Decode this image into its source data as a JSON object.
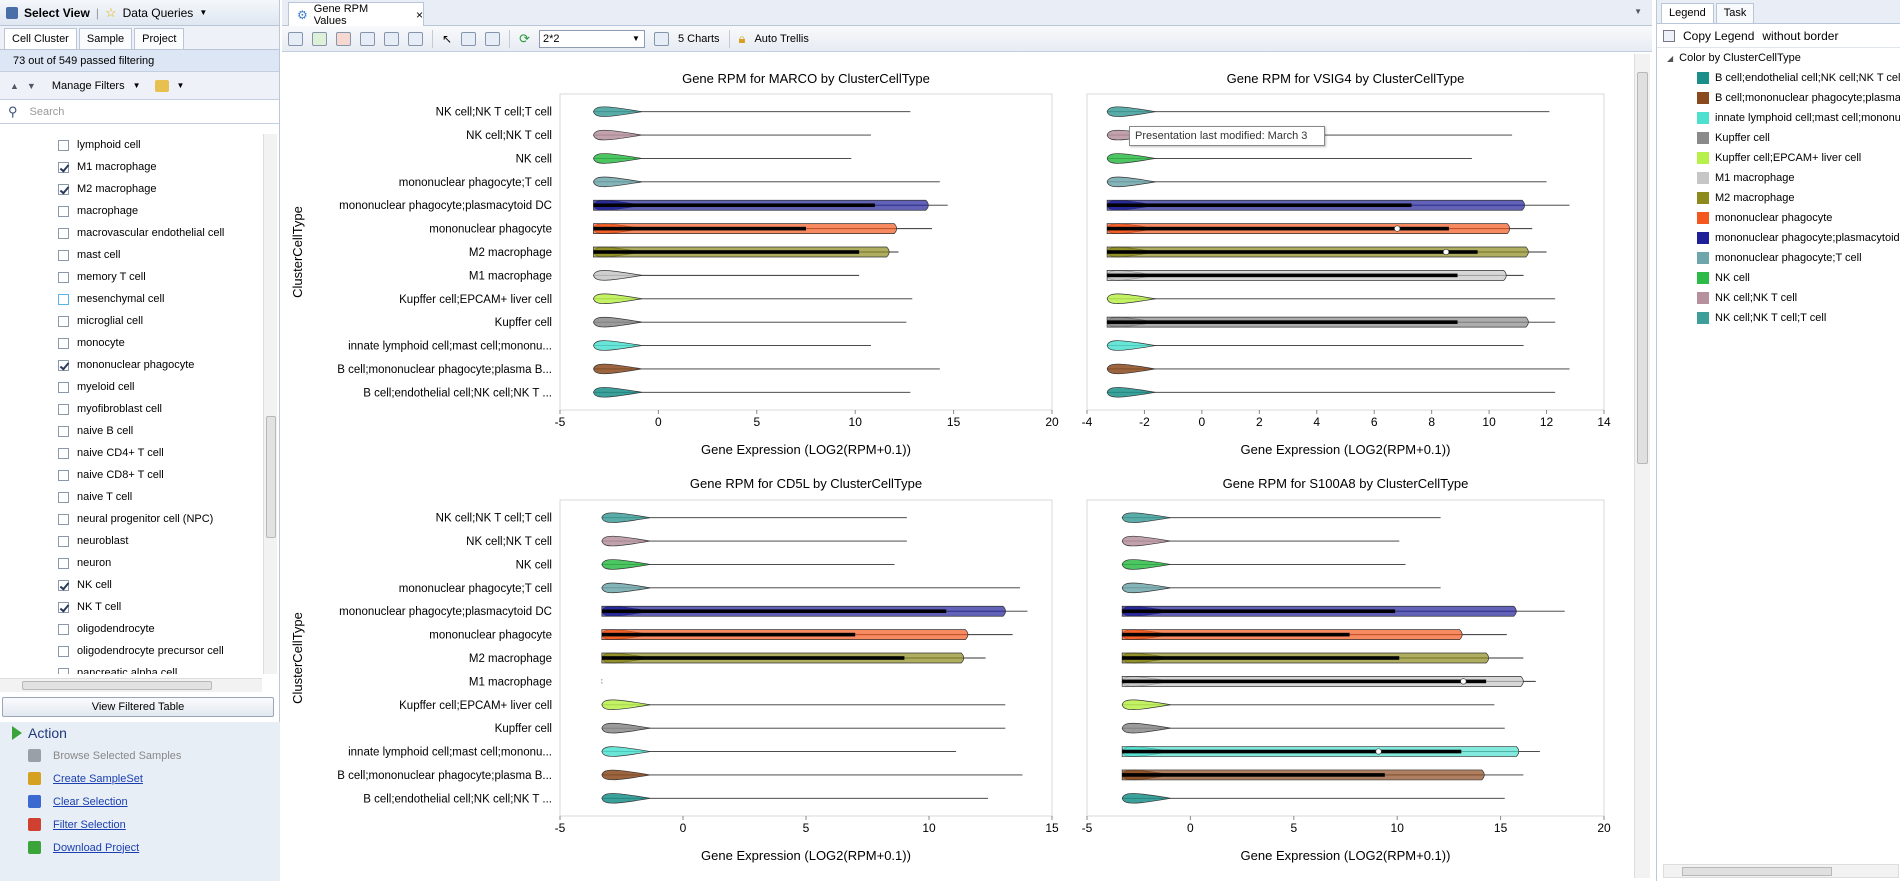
{
  "left": {
    "select_view": "Select View",
    "data_queries": "Data Queries",
    "tabs": [
      "Cell Cluster",
      "Sample",
      "Project"
    ],
    "passed": "73 out of 549 passed filtering",
    "manage_filters": "Manage Filters",
    "search_placeholder": "Search",
    "filter_items": [
      {
        "label": "lymphoid cell",
        "checked": false
      },
      {
        "label": "M1 macrophage",
        "checked": true
      },
      {
        "label": "M2 macrophage",
        "checked": true
      },
      {
        "label": "macrophage",
        "checked": false
      },
      {
        "label": "macrovascular endothelial cell",
        "checked": false
      },
      {
        "label": "mast cell",
        "checked": false
      },
      {
        "label": "memory T cell",
        "checked": false
      },
      {
        "label": "mesenchymal cell",
        "checked": false
      },
      {
        "label": "microglial cell",
        "checked": false
      },
      {
        "label": "monocyte",
        "checked": false
      },
      {
        "label": "mononuclear phagocyte",
        "checked": true
      },
      {
        "label": "myeloid cell",
        "checked": false
      },
      {
        "label": "myofibroblast cell",
        "checked": false
      },
      {
        "label": "naive B cell",
        "checked": false
      },
      {
        "label": "naive CD4+ T cell",
        "checked": false
      },
      {
        "label": "naive CD8+ T cell",
        "checked": false
      },
      {
        "label": "naive T cell",
        "checked": false
      },
      {
        "label": "neural progenitor cell (NPC)",
        "checked": false
      },
      {
        "label": "neuroblast",
        "checked": false
      },
      {
        "label": "neuron",
        "checked": false
      },
      {
        "label": "NK cell",
        "checked": true
      },
      {
        "label": "NK T cell",
        "checked": true
      },
      {
        "label": "oligodendrocyte",
        "checked": false
      },
      {
        "label": "oligodendrocyte precursor cell",
        "checked": false
      },
      {
        "label": "pancreatic alpha cell",
        "checked": false
      }
    ],
    "view_filtered_table": "View Filtered Table",
    "action_title": "Action",
    "actions": [
      {
        "label": "Browse Selected Samples",
        "enabled": false,
        "color": "#9aa0a8"
      },
      {
        "label": "Create SampleSet",
        "enabled": true,
        "color": "#d6a020"
      },
      {
        "label": "Clear Selection",
        "enabled": true,
        "color": "#3a6ad0"
      },
      {
        "label": "Filter Selection",
        "enabled": true,
        "color": "#d04030"
      },
      {
        "label": "Download Project",
        "enabled": true,
        "color": "#3aa33a"
      }
    ]
  },
  "center": {
    "tab_label": "Gene RPM Values",
    "trellis_value": "2*2",
    "charts_count": "5 Charts",
    "auto_trellis": "Auto Trellis",
    "tooltip": "Presentation last modified: March 3"
  },
  "legend": {
    "tabs": [
      "Legend",
      "Task"
    ],
    "copy_legend": "Copy Legend",
    "without_border": "without border",
    "color_by": "Color by ClusterCellType",
    "items": [
      {
        "label": "B cell;endothelial cell;NK cell;NK T cell",
        "color": "#1a8f8a"
      },
      {
        "label": "B cell;mononuclear phagocyte;plasma B",
        "color": "#8b4a1e"
      },
      {
        "label": "innate lymphoid cell;mast cell;mononucl",
        "color": "#4ee0cf"
      },
      {
        "label": "Kupffer cell",
        "color": "#8a8a8a"
      },
      {
        "label": "Kupffer cell;EPCAM+ liver cell",
        "color": "#b8f04a"
      },
      {
        "label": "M1 macrophage",
        "color": "#c6c6c6"
      },
      {
        "label": "M2 macrophage",
        "color": "#8c8a1c"
      },
      {
        "label": "mononuclear phagocyte",
        "color": "#f5581e"
      },
      {
        "label": "mononuclear phagocyte;plasmacytoid DC",
        "color": "#1f1f9a"
      },
      {
        "label": "mononuclear phagocyte;T cell",
        "color": "#6fa6ac"
      },
      {
        "label": "NK cell",
        "color": "#2dbb47"
      },
      {
        "label": "NK cell;NK T cell",
        "color": "#b6919d"
      },
      {
        "label": "NK cell;NK T cell;T cell",
        "color": "#3d9e9a"
      }
    ]
  },
  "chart_data": [
    {
      "type": "violin",
      "title": "Gene RPM for MARCO by ClusterCellType",
      "xlabel": "Gene Expression (LOG2(RPM+0.1))",
      "ylabel": "ClusterCellType",
      "xlim": [
        -5,
        20
      ],
      "xticks": [
        -5,
        0,
        5,
        10,
        15,
        20
      ],
      "categories": [
        "NK cell;NK T cell;T cell",
        "NK cell;NK T cell",
        "NK cell",
        "mononuclear phagocyte;T cell",
        "mononuclear phagocyte;plasmacytoid DC",
        "mononuclear phagocyte",
        "M2 macrophage",
        "M1 macrophage",
        "Kupffer cell;EPCAM+ liver cell",
        "Kupffer cell",
        "innate lymphoid cell;mast cell;mononu...",
        "B cell;mononuclear phagocyte;plasma B...",
        "B cell;endothelial cell;NK cell;NK T ..."
      ],
      "colors": [
        "#3d9e9a",
        "#b6919d",
        "#2dbb47",
        "#6fa6ac",
        "#1f1f9a",
        "#f5581e",
        "#8c8a1c",
        "#c6c6c6",
        "#b8f04a",
        "#8a8a8a",
        "#4ee0cf",
        "#8b4a1e",
        "#1a8f8a"
      ],
      "max": [
        12.8,
        10.8,
        9.8,
        14.3,
        14.7,
        13.9,
        12.2,
        10.2,
        12.9,
        12.6,
        10.8,
        14.3,
        12.8
      ],
      "q3": [
        -3.3,
        -3.3,
        -3.3,
        -3.3,
        11,
        7.5,
        10.2,
        -3.3,
        -3.3,
        -3.3,
        -3.3,
        -3.3,
        -3.3
      ]
    },
    {
      "type": "violin",
      "title": "Gene RPM for VSIG4 by ClusterCellType",
      "xlabel": "Gene Expression (LOG2(RPM+0.1))",
      "ylabel": "",
      "xlim": [
        -4,
        14
      ],
      "xticks": [
        -4,
        -2,
        0,
        2,
        4,
        6,
        8,
        10,
        12,
        14
      ],
      "categories": [
        "NK cell;NK T cell;T cell",
        "NK cell;NK T cell",
        "NK cell",
        "mononuclear phagocyte;T cell",
        "mononuclear phagocyte;plasmacytoid DC",
        "mononuclear phagocyte",
        "M2 macrophage",
        "M1 macrophage",
        "Kupffer cell;EPCAM+ liver cell",
        "Kupffer cell",
        "innate lymphoid cell;mast cell;mononu...",
        "B cell;mononuclear phagocyte;plasma B...",
        "B cell;endothelial cell;NK cell;NK T ..."
      ],
      "colors": [
        "#3d9e9a",
        "#b6919d",
        "#2dbb47",
        "#6fa6ac",
        "#1f1f9a",
        "#f5581e",
        "#8c8a1c",
        "#c6c6c6",
        "#b8f04a",
        "#8a8a8a",
        "#4ee0cf",
        "#8b4a1e",
        "#1a8f8a"
      ],
      "max": [
        12.1,
        10.8,
        9.4,
        12.0,
        12.8,
        11.5,
        12.0,
        11.2,
        12.3,
        12.3,
        11.2,
        12.8,
        12.3
      ],
      "q3": [
        -3.3,
        -3.3,
        -3.3,
        -3.3,
        7.3,
        8.6,
        9.6,
        8.9,
        -3.3,
        8.9,
        -3.3,
        -3.3,
        -3.3
      ],
      "median": [
        null,
        null,
        null,
        null,
        null,
        6.8,
        8.5,
        null,
        null,
        null,
        null,
        null,
        null
      ]
    },
    {
      "type": "violin",
      "title": "Gene RPM for CD5L by ClusterCellType",
      "xlabel": "Gene Expression (LOG2(RPM+0.1))",
      "ylabel": "ClusterCellType",
      "xlim": [
        -5,
        15
      ],
      "xticks": [
        -5,
        0,
        5,
        10,
        15
      ],
      "categories": [
        "NK cell;NK T cell;T cell",
        "NK cell;NK T cell",
        "NK cell",
        "mononuclear phagocyte;T cell",
        "mononuclear phagocyte;plasmacytoid DC",
        "mononuclear phagocyte",
        "M2 macrophage",
        "M1 macrophage",
        "Kupffer cell;EPCAM+ liver cell",
        "Kupffer cell",
        "innate lymphoid cell;mast cell;mononu...",
        "B cell;mononuclear phagocyte;plasma B...",
        "B cell;endothelial cell;NK cell;NK T ..."
      ],
      "colors": [
        "#3d9e9a",
        "#b6919d",
        "#2dbb47",
        "#6fa6ac",
        "#1f1f9a",
        "#f5581e",
        "#8c8a1c",
        "#c6c6c6",
        "#b8f04a",
        "#8a8a8a",
        "#4ee0cf",
        "#8b4a1e",
        "#1a8f8a"
      ],
      "max": [
        9.1,
        9.1,
        8.6,
        13.7,
        14.0,
        13.4,
        12.3,
        -3.3,
        13.1,
        13.1,
        11.1,
        13.8,
        12.4
      ],
      "q3": [
        -3.3,
        -3.3,
        -3.3,
        -3.3,
        10.7,
        7.0,
        9.0,
        -3.3,
        -3.3,
        -3.3,
        -3.3,
        -3.3,
        -3.3
      ]
    },
    {
      "type": "violin",
      "title": "Gene RPM for S100A8 by ClusterCellType",
      "xlabel": "Gene Expression (LOG2(RPM+0.1))",
      "ylabel": "",
      "xlim": [
        -5,
        20
      ],
      "xticks": [
        -5,
        0,
        5,
        10,
        15,
        20
      ],
      "categories": [
        "NK cell;NK T cell;T cell",
        "NK cell;NK T cell",
        "NK cell",
        "mononuclear phagocyte;T cell",
        "mononuclear phagocyte;plasmacytoid DC",
        "mononuclear phagocyte",
        "M2 macrophage",
        "M1 macrophage",
        "Kupffer cell;EPCAM+ liver cell",
        "Kupffer cell",
        "innate lymphoid cell;mast cell;mononu...",
        "B cell;mononuclear phagocyte;plasma B...",
        "B cell;endothelial cell;NK cell;NK T ..."
      ],
      "colors": [
        "#3d9e9a",
        "#b6919d",
        "#2dbb47",
        "#6fa6ac",
        "#1f1f9a",
        "#f5581e",
        "#8c8a1c",
        "#c6c6c6",
        "#b8f04a",
        "#8a8a8a",
        "#4ee0cf",
        "#8b4a1e",
        "#1a8f8a"
      ],
      "max": [
        12.1,
        10.1,
        10.4,
        12.1,
        18.1,
        15.3,
        16.1,
        16.7,
        14.7,
        15.2,
        16.9,
        16.1,
        15.2
      ],
      "q3": [
        -3.3,
        -3.3,
        -3.3,
        -3.3,
        9.9,
        7.7,
        10.1,
        14.3,
        -3.3,
        -3.3,
        13.1,
        9.4,
        -3.3
      ],
      "median": [
        null,
        null,
        null,
        null,
        null,
        null,
        null,
        13.2,
        null,
        null,
        9.1,
        null,
        null
      ]
    }
  ]
}
